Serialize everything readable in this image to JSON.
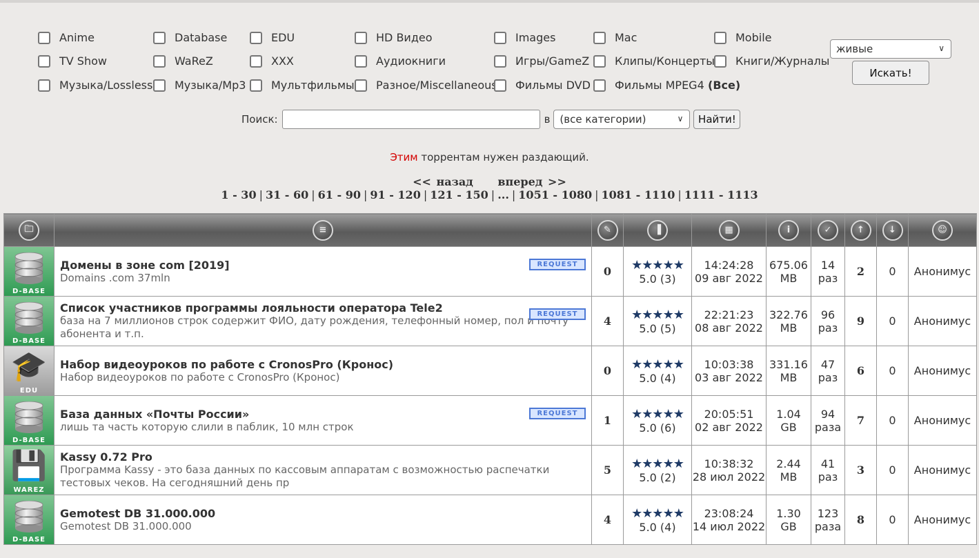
{
  "categories": {
    "rows": [
      [
        "Anime",
        "Database",
        "EDU",
        "HD Видео",
        "Images",
        "Mac",
        "Mobile"
      ],
      [
        "TV Show",
        "WaReZ",
        "XXX",
        "Аудиокниги",
        "Игры/GameZ",
        "Клипы/Концерты",
        "Книги/Журналы"
      ],
      [
        "Музыка/Lossless",
        "Музыка/Mp3",
        "Мультфильмы",
        "Разное/Miscellaneous",
        "Фильмы DVD",
        "Фильмы MPEG4"
      ]
    ],
    "all_label": "(Все)"
  },
  "filter": {
    "select_value": "живые",
    "button_label": "Искать!"
  },
  "search": {
    "label": "Поиск:",
    "value": "",
    "in_label": "в",
    "category_value": "(все категории)",
    "button_label": "Найти!"
  },
  "notice": {
    "highlight": "Этим",
    "rest": " торрентам нужен раздающий."
  },
  "pager": {
    "prev": "<< назад",
    "next": "вперед >>",
    "pages": [
      "1 - 30",
      "31 - 60",
      "61 - 90",
      "91 - 120",
      "121 - 150",
      "...",
      "1051 - 1080",
      "1081 - 1110",
      "1111 - 1113"
    ]
  },
  "table": {
    "header_icons": [
      "category-icon",
      "name-icon",
      "comments-icon",
      "rating-icon",
      "date-icon",
      "size-icon",
      "completed-icon",
      "seeders-icon",
      "leechers-icon",
      "uploader-icon"
    ],
    "rows": [
      {
        "category": "D-BASE",
        "title": "Домены в зоне com [2019]",
        "desc": "Domains .com 37mln",
        "request": "REQUEST",
        "comments": "0",
        "stars": "★★★★★",
        "rating": "5.0 (3)",
        "time": "14:24:28",
        "date": "09 авг 2022",
        "size_val": "675.06",
        "size_unit": "MB",
        "completed_n": "14",
        "completed_u": "раз",
        "seeders": "2",
        "leechers": "0",
        "uploader": "Анонимус"
      },
      {
        "category": "D-BASE",
        "title": "Список участников программы лояльности оператора Tele2",
        "desc": "база на 7 миллионов строк содержит ФИО, дату рождения, телефонный номер, пол и почту абонента и т.п.",
        "request": "REQUEST",
        "comments": "4",
        "stars": "★★★★★",
        "rating": "5.0 (5)",
        "time": "22:21:23",
        "date": "08 авг 2022",
        "size_val": "322.76",
        "size_unit": "MB",
        "completed_n": "96",
        "completed_u": "раз",
        "seeders": "9",
        "leechers": "0",
        "uploader": "Анонимус"
      },
      {
        "category": "EDU",
        "title": "Набор видеоуроков по работе с CronosPro (Кронос)",
        "desc": "Набор видеоуроков по работе с CronosPro (Кронос)",
        "request": "",
        "comments": "0",
        "stars": "★★★★★",
        "rating": "5.0 (4)",
        "time": "10:03:38",
        "date": "03 авг 2022",
        "size_val": "331.16",
        "size_unit": "MB",
        "completed_n": "47",
        "completed_u": "раз",
        "seeders": "6",
        "leechers": "0",
        "uploader": "Анонимус"
      },
      {
        "category": "D-BASE",
        "title": "База данных «Почты России»",
        "desc": "лишь та часть которую слили в паблик, 10 млн строк",
        "request": "REQUEST",
        "comments": "1",
        "stars": "★★★★★",
        "rating": "5.0 (6)",
        "time": "20:05:51",
        "date": "02 авг 2022",
        "size_val": "1.04",
        "size_unit": "GB",
        "completed_n": "94",
        "completed_u": "раза",
        "seeders": "7",
        "leechers": "0",
        "uploader": "Анонимус"
      },
      {
        "category": "WAREZ",
        "title": "Kassy 0.72 Pro",
        "desc": "Программа Kassy - это база данных по кассовым аппаратам с возможностью распечатки тестовых чеков. На сегодняшний день пр",
        "request": "",
        "comments": "5",
        "stars": "★★★★★",
        "rating": "5.0 (2)",
        "time": "10:38:32",
        "date": "28 июл 2022",
        "size_val": "2.44",
        "size_unit": "MB",
        "completed_n": "41",
        "completed_u": "раз",
        "seeders": "3",
        "leechers": "0",
        "uploader": "Анонимус"
      },
      {
        "category": "D-BASE",
        "title": "Gemotest DB 31.000.000",
        "desc": "Gemotest DB 31.000.000",
        "request": "",
        "comments": "4",
        "stars": "★★★★★",
        "rating": "5.0 (4)",
        "time": "23:08:24",
        "date": "14 июл 2022",
        "size_val": "1.30",
        "size_unit": "GB",
        "completed_n": "123",
        "completed_u": "раза",
        "seeders": "8",
        "leechers": "0",
        "uploader": "Анонимус"
      }
    ]
  }
}
